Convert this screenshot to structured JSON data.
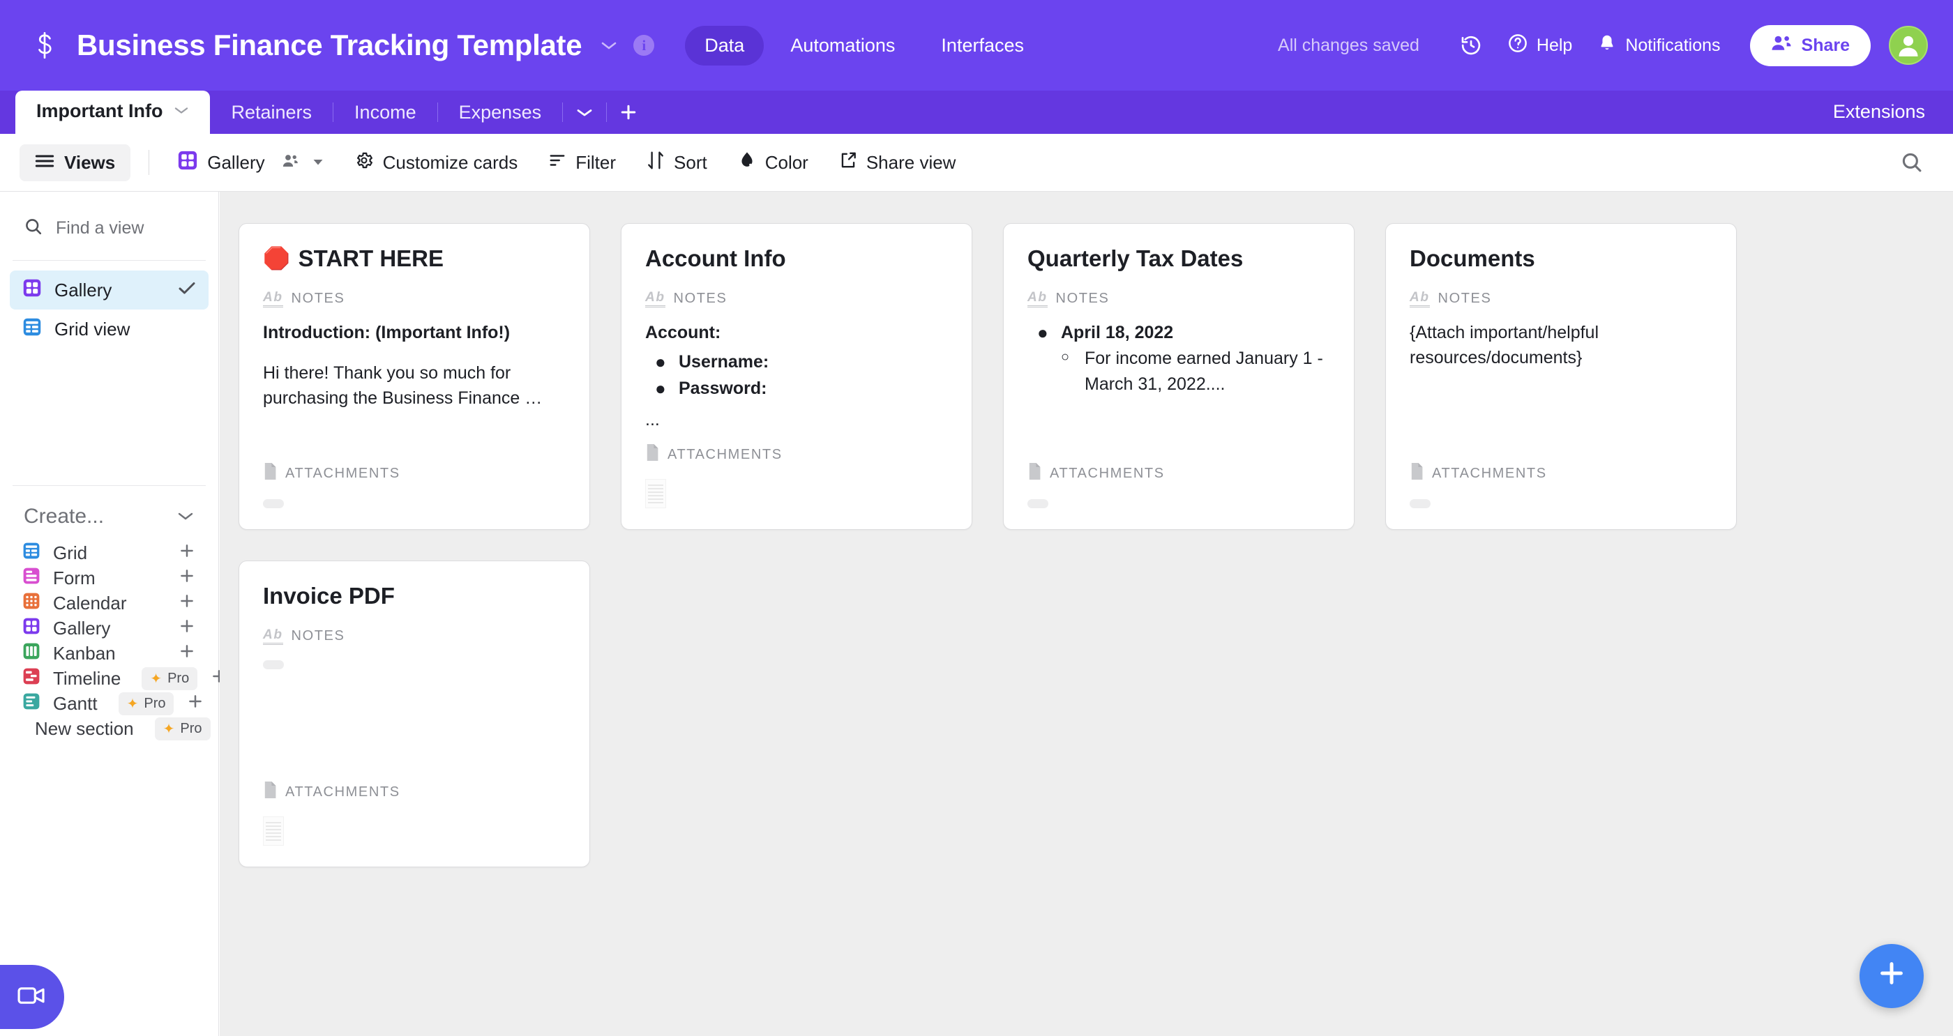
{
  "header": {
    "logo_icon": "dollar-sign-icon",
    "title": "Business Finance Tracking Template",
    "title_caret_icon": "chevron-down-icon",
    "info_icon": "info-icon",
    "nav": [
      {
        "label": "Data",
        "active": true
      },
      {
        "label": "Automations",
        "active": false
      },
      {
        "label": "Interfaces",
        "active": false
      }
    ],
    "saved_status": "All changes saved",
    "history_icon": "history-clock-icon",
    "help_icon": "question-circle-icon",
    "help_label": "Help",
    "notifications_icon": "bell-icon",
    "notifications_label": "Notifications",
    "share_icon": "people-icon",
    "share_label": "Share",
    "avatar_icon": "user-avatar-icon",
    "avatar_color": "#8fd14f",
    "brand_color": "#6b44ef"
  },
  "tabs": {
    "items": [
      {
        "label": "Important Info",
        "active": true
      },
      {
        "label": "Retainers",
        "active": false
      },
      {
        "label": "Income",
        "active": false
      },
      {
        "label": "Expenses",
        "active": false
      }
    ],
    "overflow_icon": "chevron-down-icon",
    "add_icon": "plus-icon",
    "extensions_label": "Extensions"
  },
  "toolbar": {
    "views_icon": "hamburger-icon",
    "views_label": "Views",
    "view_type_icon": "gallery-icon",
    "view_type_label": "Gallery",
    "collaborators_icon": "people-icon",
    "view_caret_icon": "caret-down-icon",
    "customize_icon": "gear-icon",
    "customize_label": "Customize cards",
    "filter_icon": "filter-icon",
    "filter_label": "Filter",
    "sort_icon": "sort-arrows-icon",
    "sort_label": "Sort",
    "color_icon": "paint-drop-icon",
    "color_label": "Color",
    "share_view_icon": "share-external-icon",
    "share_view_label": "Share view",
    "search_icon": "search-icon"
  },
  "sidebar": {
    "search_icon": "search-icon",
    "find_view_placeholder": "Find a view",
    "views": [
      {
        "label": "Gallery",
        "icon": "gallery-icon",
        "color": "#7c3aed",
        "active": true,
        "check_icon": "check-icon"
      },
      {
        "label": "Grid view",
        "icon": "grid-icon",
        "color": "#2d8ce0",
        "active": false
      }
    ],
    "create_title": "Create...",
    "create_chevron_icon": "chevron-down-icon",
    "create_items": [
      {
        "label": "Grid",
        "icon": "grid-icon",
        "color": "#2d8ce0",
        "pro": false,
        "plus_icon": "plus-icon"
      },
      {
        "label": "Form",
        "icon": "form-icon",
        "color": "#d84fd0",
        "pro": false,
        "plus_icon": "plus-icon"
      },
      {
        "label": "Calendar",
        "icon": "calendar-icon",
        "color": "#e8703a",
        "pro": false,
        "plus_icon": "plus-icon"
      },
      {
        "label": "Gallery",
        "icon": "gallery-icon",
        "color": "#7c3aed",
        "pro": false,
        "plus_icon": "plus-icon"
      },
      {
        "label": "Kanban",
        "icon": "kanban-icon",
        "color": "#3ba55c",
        "pro": false,
        "plus_icon": "plus-icon"
      },
      {
        "label": "Timeline",
        "icon": "timeline-icon",
        "color": "#dc3f53",
        "pro": true,
        "pro_label": "Pro",
        "plus_icon": "plus-icon"
      },
      {
        "label": "Gantt",
        "icon": "gantt-icon",
        "color": "#3aa8a0",
        "pro": true,
        "pro_label": "Pro",
        "plus_icon": "plus-icon"
      },
      {
        "label": "New section",
        "icon": "section-icon",
        "color": "#8e9096",
        "pro": true,
        "pro_label": "Pro",
        "plus_icon": "plus-icon"
      }
    ],
    "record_button_icon": "video-camera-icon"
  },
  "cards": {
    "notes_field_label": "NOTES",
    "attachments_field_label": "ATTACHMENTS",
    "notes_icon": "long-text-ab-icon",
    "attachments_icon": "file-icon",
    "items": [
      {
        "emoji": "🛑",
        "title": "START HERE",
        "notes_lines": [
          {
            "text": "Introduction: (Important Info!)",
            "bold": true,
            "indent": 0
          },
          {
            "text": "Hi there! Thank you so much for purchasing the Business Finance …",
            "bold": false,
            "indent": 0
          }
        ],
        "thumb": "pill"
      },
      {
        "emoji": "",
        "title": "Account Info",
        "notes_lines": [
          {
            "text": "Account:",
            "bold": true,
            "indent": 0
          },
          {
            "text": "Username:",
            "bold": true,
            "indent": 1,
            "bullet": "●"
          },
          {
            "text": "Password:",
            "bold": true,
            "indent": 1,
            "bullet": "●"
          },
          {
            "text": "...",
            "bold": false,
            "indent": 0
          }
        ],
        "thumb": "doc"
      },
      {
        "emoji": "",
        "title": "Quarterly Tax Dates",
        "notes_lines": [
          {
            "text": "April 18, 2022",
            "bold": true,
            "indent": 1,
            "bullet": "●"
          },
          {
            "text": "For income earned January 1 - March 31, 2022....",
            "bold": false,
            "indent": 2,
            "bullet": "○"
          }
        ],
        "thumb": "pill"
      },
      {
        "emoji": "",
        "title": "Documents",
        "notes_lines": [
          {
            "text": "{Attach important/helpful resources/documents}",
            "bold": false,
            "indent": 0
          }
        ],
        "thumb": "pill"
      },
      {
        "emoji": "",
        "title": "Invoice PDF",
        "notes_lines": [],
        "notes_thumb": "pill",
        "thumb": "doc"
      }
    ],
    "fab_icon": "plus-icon"
  }
}
